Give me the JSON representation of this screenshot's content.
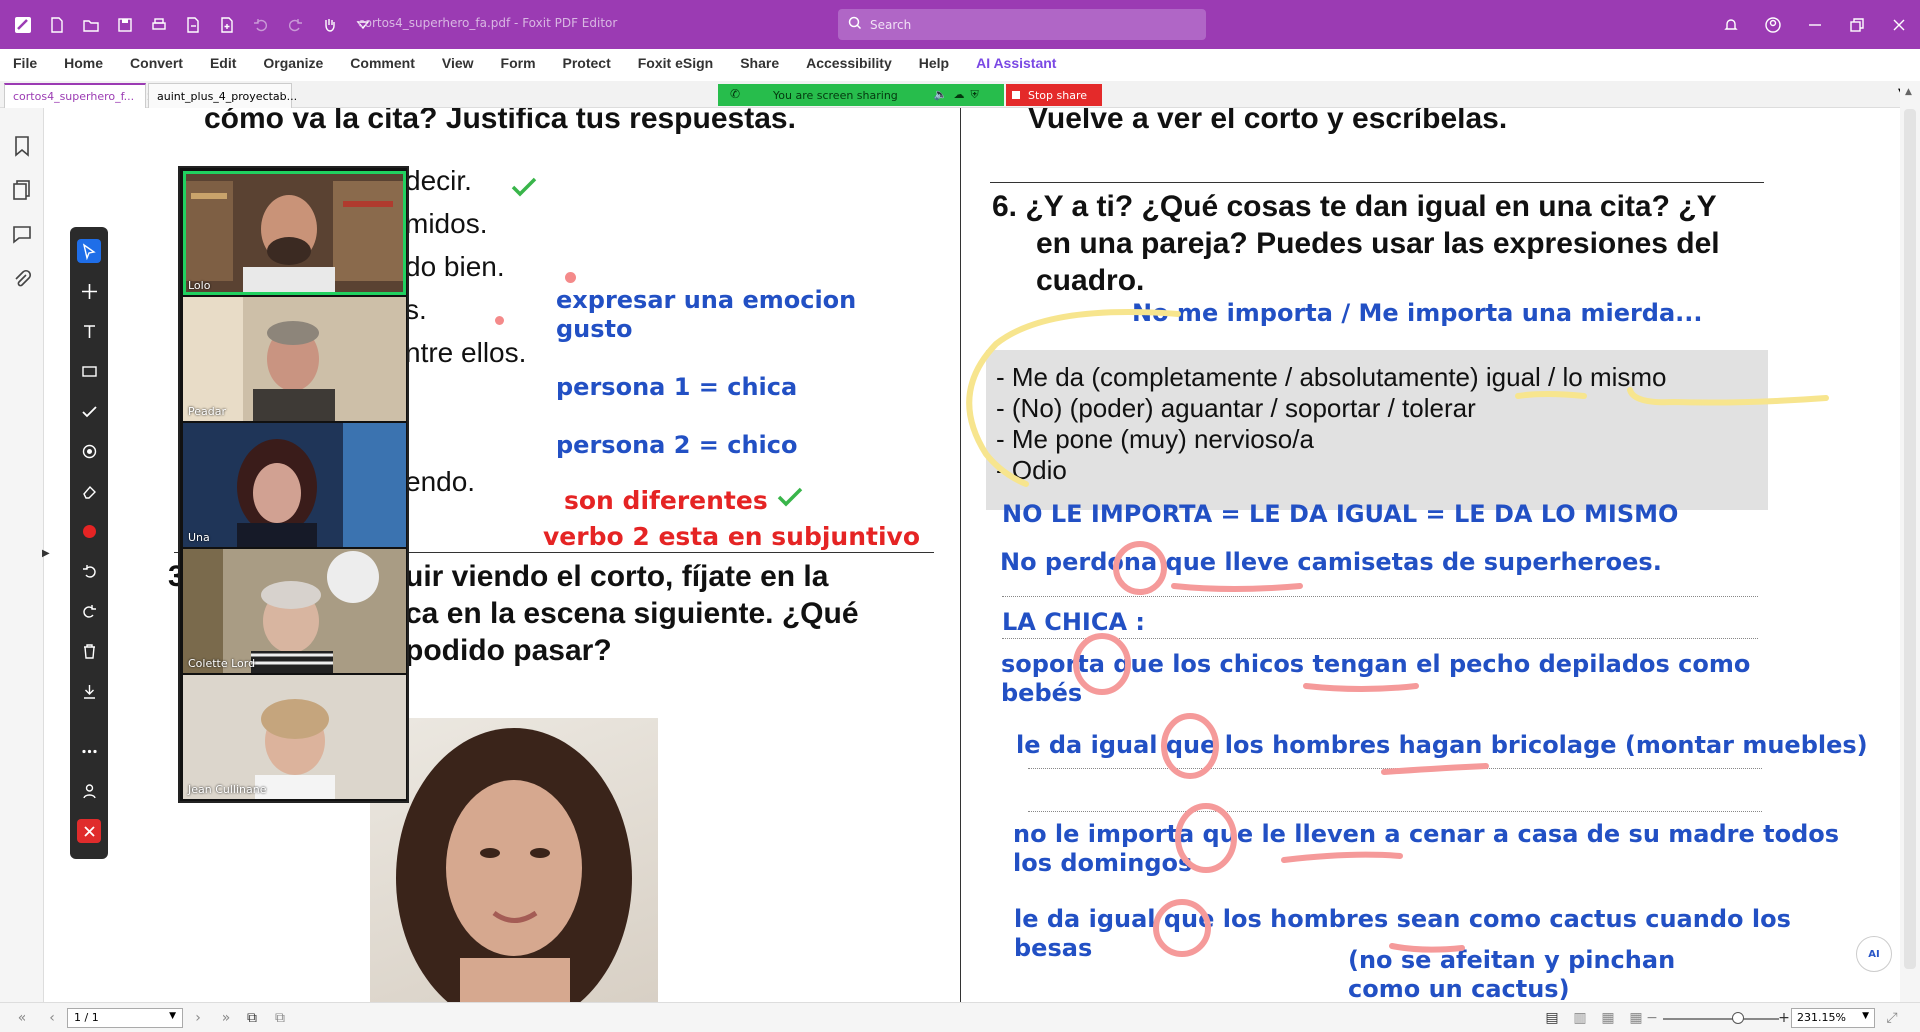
{
  "app": {
    "document_title": "cortos4_superhero_fa.pdf - Foxit PDF Editor",
    "search_placeholder": "Search",
    "accent_color": "#9b3bb3"
  },
  "menu": [
    "File",
    "Home",
    "Convert",
    "Edit",
    "Organize",
    "Comment",
    "View",
    "Form",
    "Protect",
    "Foxit eSign",
    "Share",
    "Accessibility",
    "Help",
    "AI Assistant"
  ],
  "tabs": [
    {
      "label": "cortos4_superhero_f...",
      "active": true
    },
    {
      "label": "auint_plus_4_proyectab...",
      "active": false
    }
  ],
  "screen_share": {
    "message": "You are screen sharing",
    "stop_label": "Stop share"
  },
  "video_participants": [
    {
      "name": "Lolo",
      "active_speaker": true
    },
    {
      "name": "Peadar",
      "active_speaker": false
    },
    {
      "name": "Una",
      "active_speaker": false
    },
    {
      "name": "Colette Lord",
      "active_speaker": false
    },
    {
      "name": "Jean Cullinane",
      "active_speaker": false
    }
  ],
  "left_page": {
    "heading_top": "cómo va la cita? Justifica tus respuestas.",
    "fragments": [
      "decir.",
      "midos.",
      "do bien.",
      "s.",
      "ntre ellos.",
      "endo."
    ],
    "section3_number": "3",
    "section3_lines": [
      "uir viendo el corto, fíjate en la",
      "ca en la escena siguiente. ¿Qué",
      "podido pasar?"
    ],
    "annotations_blue": [
      "expresar una emocion",
      "gusto",
      "persona 1 = chica",
      "persona 2 = chico"
    ],
    "annotations_red": [
      "son diferentes",
      "verbo 2 esta en subjuntivo"
    ]
  },
  "right_page": {
    "heading_top": "Vuelve a ver el corto y escríbelas.",
    "question6": [
      "6. ¿Y a ti? ¿Qué cosas te dan igual en una cita? ¿Y",
      "en una pareja?  Puedes usar las expresiones del",
      "cuadro."
    ],
    "note_top": "No me importa / Me importa una mierda...",
    "expressions": [
      "- Me da (completamente / absolutamente) igual / lo mismo",
      "- (No) (poder) aguantar / soportar / tolerar",
      "- Me pone (muy) nervioso/a",
      "- Odio"
    ],
    "notes": [
      "NO LE IMPORTA = LE DA IGUAL = LE DA LO MISMO",
      "No perdona que lleve camisetas de superheroes.",
      "LA CHICA :",
      "soporta que los chicos tengan el pecho depilados como",
      "bebés",
      "le da igual que los hombres hagan bricolage (montar muebles)",
      "no le importa que le lleven a cenar a casa de su madre todos",
      "los domingos",
      "le da igual que los hombres sean como cactus cuando los",
      "besas",
      "(no se afeitan y pinchan",
      "como un cactus)"
    ]
  },
  "status": {
    "page": "1 / 1",
    "zoom": "231.15%"
  }
}
